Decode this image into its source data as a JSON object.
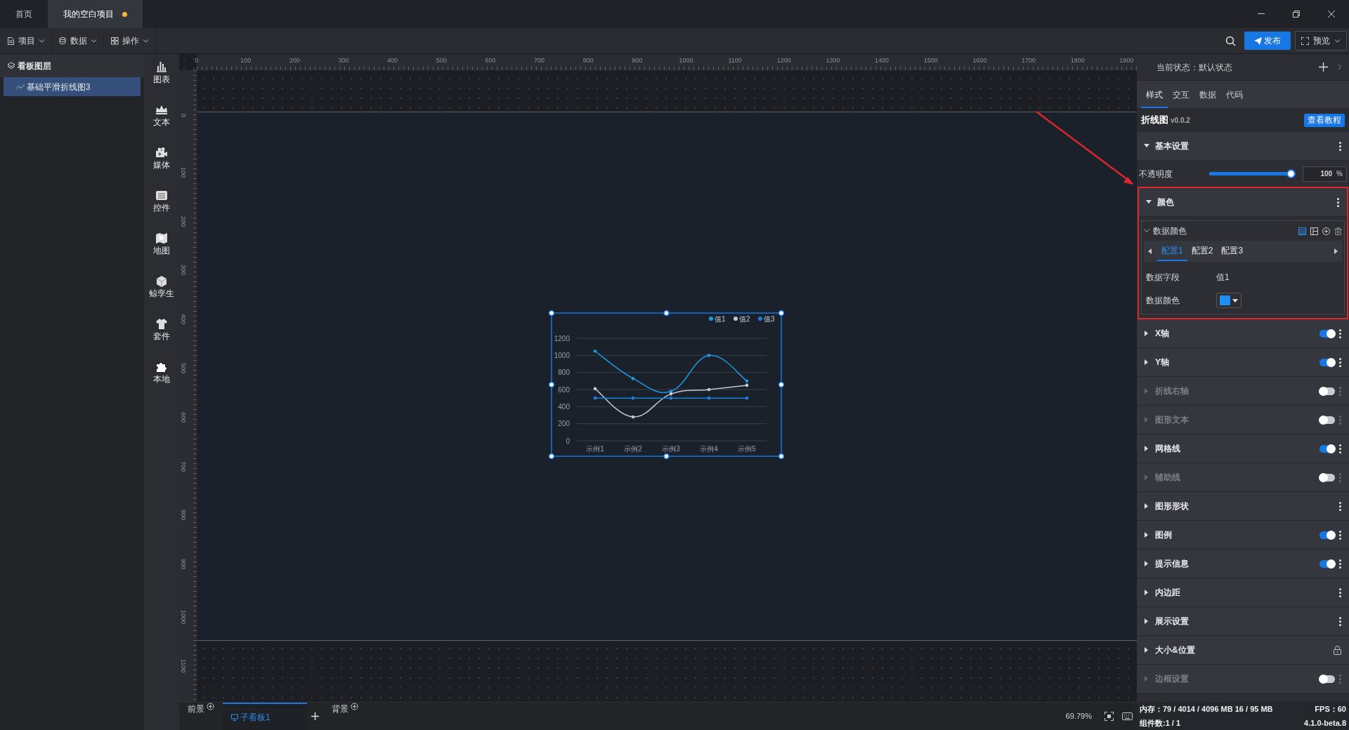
{
  "tabs": [
    {
      "label": "首页",
      "selected": false,
      "modified": false
    },
    {
      "label": "我的空白项目",
      "selected": true,
      "modified": true
    }
  ],
  "menus": [
    "项目",
    "数据",
    "操作"
  ],
  "toolbar": {
    "publish": "发布",
    "preview": "预览"
  },
  "layers": {
    "title": "看板图层",
    "items": [
      {
        "label": "基础平滑折线图3",
        "selected": true
      }
    ]
  },
  "components": [
    "图表",
    "文本",
    "媒体",
    "控件",
    "地图",
    "鲸孪生",
    "套件",
    "本地"
  ],
  "ruler": {
    "x_labels": [
      "0",
      "100",
      "200",
      "300",
      "400",
      "500",
      "600",
      "700",
      "800",
      "900",
      "1000",
      "1100",
      "1200",
      "1300",
      "1400",
      "1500",
      "1600",
      "1700",
      "1800",
      "1900"
    ],
    "y_labels": [
      "0",
      "100",
      "200",
      "300",
      "400",
      "500",
      "600",
      "700",
      "800",
      "900",
      "1000",
      "1100"
    ]
  },
  "chart": {
    "selected": true,
    "chart_data": {
      "type": "line",
      "grid": true,
      "legend": "top-right",
      "categories": [
        "示例1",
        "示例2",
        "示例3",
        "示例4",
        "示例5"
      ],
      "ylim": [
        0,
        1200
      ],
      "yticks": [
        0,
        200,
        400,
        600,
        800,
        1000,
        1200
      ],
      "series": [
        {
          "name": "值1",
          "color": "#1c9ae6",
          "values": [
            1050,
            730,
            580,
            1000,
            700
          ]
        },
        {
          "name": "值2",
          "color": "#c3c8d2",
          "values": [
            610,
            280,
            550,
            600,
            650
          ]
        },
        {
          "name": "值3",
          "color": "#1a7edc",
          "values": [
            500,
            500,
            500,
            500,
            500
          ]
        }
      ]
    }
  },
  "bottom_bar": {
    "foreground": "前景",
    "boards": [
      {
        "label": "子看板1",
        "selected": true
      }
    ],
    "background": "背景",
    "zoom": "69.79%"
  },
  "panel": {
    "state_label": "当前状态：默认状态",
    "tabs": [
      {
        "label": "样式",
        "selected": true
      },
      {
        "label": "交互",
        "selected": false
      },
      {
        "label": "数据",
        "selected": false
      },
      {
        "label": "代码",
        "selected": false
      }
    ],
    "title": "折线图",
    "version": "v0.0.2",
    "tutorial": "查看教程",
    "sections": [
      {
        "label": "基本设置",
        "kind": "opacity",
        "expanded": true,
        "opacity": {
          "label": "不透明度",
          "level": 1,
          "value": "100",
          "unit": "%"
        }
      },
      {
        "label": "颜色",
        "kind": "colors",
        "expanded": true,
        "highlighted": true,
        "colors": {
          "title": "数据颜色",
          "expanded": true,
          "configs": [
            {
              "label": "配置1",
              "selected": true
            },
            {
              "label": "配置2",
              "selected": false
            },
            {
              "label": "配置3",
              "selected": false
            }
          ],
          "field_label": "数据字段",
          "field_value": "值1",
          "color_label": "数据颜色",
          "color": "#1e8ff0"
        }
      },
      {
        "label": "X轴",
        "kind": "toggle",
        "expanded": false,
        "on": true
      },
      {
        "label": "Y轴",
        "kind": "toggle",
        "expanded": false,
        "on": true
      },
      {
        "label": "折线右轴",
        "kind": "toggle",
        "expanded": false,
        "on": false
      },
      {
        "label": "图形文本",
        "kind": "toggle",
        "expanded": false,
        "on": false
      },
      {
        "label": "网格线",
        "kind": "toggle",
        "expanded": false,
        "on": true
      },
      {
        "label": "辅助线",
        "kind": "toggle",
        "expanded": false,
        "on": false
      },
      {
        "label": "图形形状",
        "kind": "plain",
        "expanded": false
      },
      {
        "label": "图例",
        "kind": "toggle",
        "expanded": false,
        "on": true
      },
      {
        "label": "提示信息",
        "kind": "toggle",
        "expanded": false,
        "on": true
      },
      {
        "label": "内边距",
        "kind": "plain",
        "expanded": false
      },
      {
        "label": "展示设置",
        "kind": "plain",
        "expanded": false
      },
      {
        "label": "大小&位置",
        "kind": "lock",
        "expanded": false
      },
      {
        "label": "边框设置",
        "kind": "toggle",
        "expanded": false,
        "on": false
      }
    ],
    "status": {
      "memory": "内存：79 / 4014 / 4096 MB 16 / 95 MB",
      "fps": "FPS：60",
      "count": "组件数:1 / 1",
      "version": "4.1.0-beta.8"
    }
  }
}
